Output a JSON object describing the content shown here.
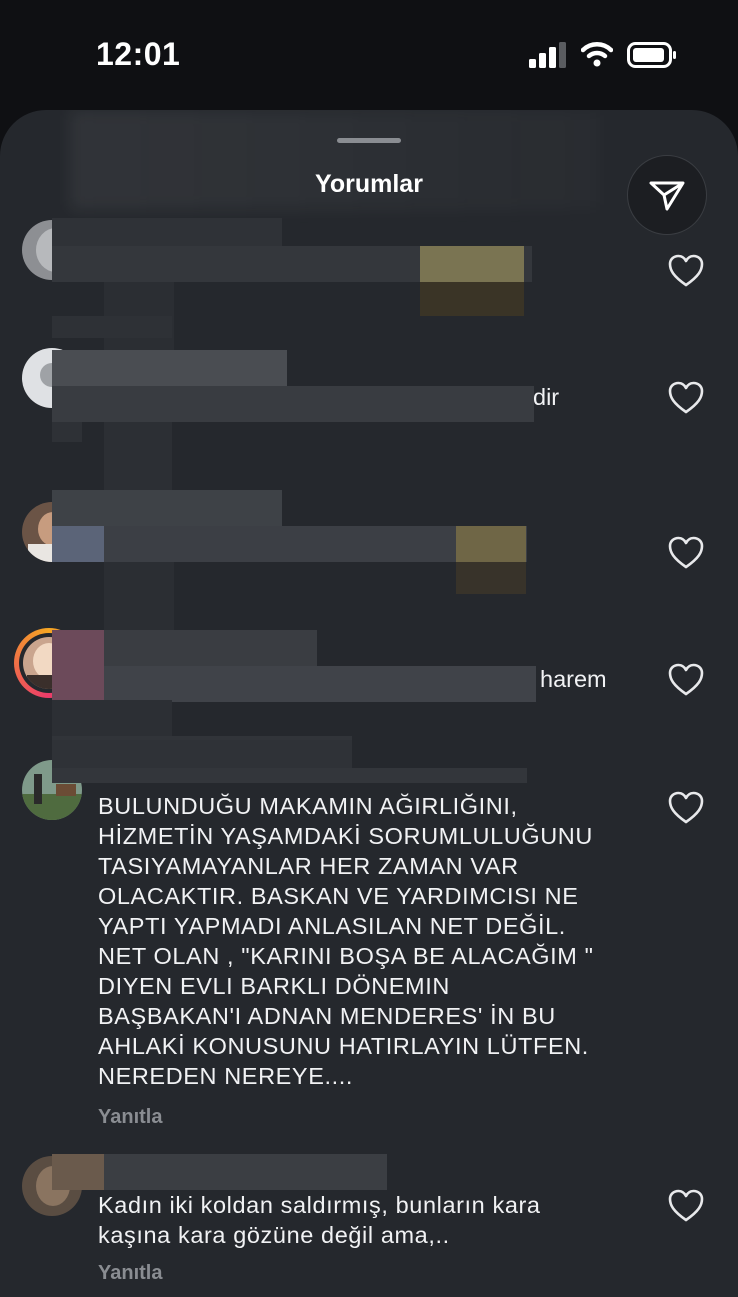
{
  "status": {
    "time": "12:01"
  },
  "sheet": {
    "title": "Yorumlar",
    "share_icon": "send-icon"
  },
  "colors": {
    "background": "#0f1013",
    "sheet": "#25282d",
    "muted": "#8a8d92",
    "story_ring": "#f5a623"
  },
  "comments": [
    {
      "tail": ""
    },
    {
      "tail": "dir"
    },
    {
      "tail": ""
    },
    {
      "tail": "harem"
    },
    {
      "text": "BULUNDUĞU MAKAMIN AĞIRLIĞINI,\nHİZMETİN YAŞAMDAKİ SORUMLULUĞUNU\nTASIYAMAYANLAR HER ZAMAN VAR\nOLACAKTIR.  BASKAN VE YARDIMCISI  NE\nYAPTI YAPMADI ANLASILAN NET DEĞİL.\nNET OLAN , \"KARINI BOŞA BE ALACAĞIM \"\nDIYEN EVLI BARKLI  DÖNEMIN\nBAŞBAKAN'I  ADNAN MENDERES' İN  BU\nAHLAKİ  KONUSUNU HATIRLAYIN  LÜTFEN.\nNEREDEN  NEREYE....",
      "reply": "Yanıtla"
    },
    {
      "text": "Kadın iki koldan saldırmış, bunların kara\nkaşına kara gözüne değil ama,..",
      "reply": "Yanıtla"
    }
  ]
}
